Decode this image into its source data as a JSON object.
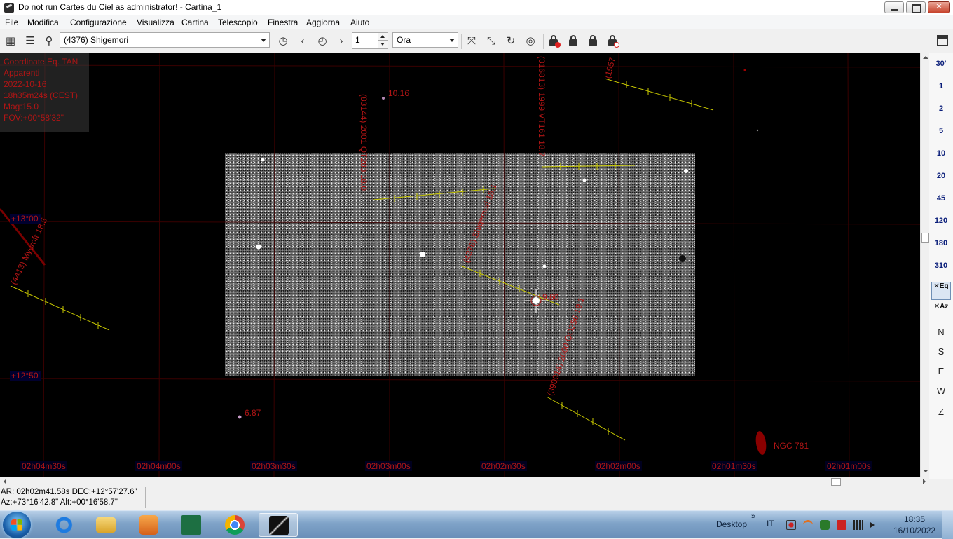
{
  "window": {
    "title": "Do not run Cartes du Ciel as administrator! - Cartina_1"
  },
  "menu": [
    "File",
    "Modifica",
    "Configurazione",
    "Visualizza",
    "Cartina",
    "Telescopio",
    "Finestra",
    "Aggiorna",
    "Aiuto"
  ],
  "toolbar": {
    "search_value": "(4376) Shigemori",
    "step_value": "1",
    "time_unit": "Ora"
  },
  "info_panel": {
    "lines": [
      "Coordinate Eq. TAN",
      "Apparenti",
      "2022-10-16",
      "18h35m24s (CEST)",
      "Mag:15.0",
      "FOV:+00°58'32\""
    ]
  },
  "chart": {
    "ra_labels": [
      "02h04m30s",
      "02h04m00s",
      "02h03m30s",
      "02h03m00s",
      "02h02m30s",
      "02h02m00s",
      "02h01m30s",
      "02h01m00s"
    ],
    "dec_labels": [
      "+13°00'",
      "+12°50'"
    ],
    "asteroids": [
      "(4413) Mycroft 18.5",
      "(83144) 2001 QT283 18.0",
      "(4376) Shigemori 18.1",
      "(316813) 1999 VT161 18.7",
      "(390914) 2000 QO256 19.1",
      "(1957"
    ],
    "star_mags": [
      "10.16",
      "6.87",
      "9.60"
    ],
    "galaxy_label": "NGC 781"
  },
  "fov_list": [
    "30'",
    "1",
    "2",
    "5",
    "10",
    "20",
    "45",
    "120",
    "180",
    "310"
  ],
  "projection_buttons": [
    "Eq",
    "Az"
  ],
  "direction_buttons": [
    "N",
    "S",
    "E",
    "W",
    "Z"
  ],
  "status": {
    "line1": "AR: 02h02m41.58s DEC:+12°57'27.6\"",
    "line2": "Az:+73°16'42.8\" Alt:+00°16'58.7\""
  },
  "taskbar": {
    "desktop_label": "Desktop",
    "lang": "IT",
    "time": "18:35",
    "date": "16/10/2022"
  }
}
